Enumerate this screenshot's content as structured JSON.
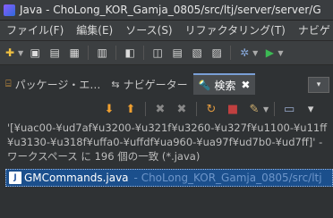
{
  "window": {
    "title": "Java - ChoLong_KOR_Gamja_0805/src/ltj/server/server/G"
  },
  "menu": {
    "items": [
      "ファイル(F)",
      "編集(E)",
      "ソース(S)",
      "リファクタリング(T)",
      "ナビゲ"
    ]
  },
  "views": {
    "tabs": [
      {
        "label": "パッケージ・エ…"
      },
      {
        "label": "ナビゲーター"
      },
      {
        "label": "検索"
      }
    ],
    "close_glyph": "✖",
    "minmax_glyph": "▾"
  },
  "search": {
    "query_line": "'[¥uac00-¥ud7af¥u3200-¥u321f¥u3260-¥u327f¥u1100-¥u11ff¥u3130-¥u318f¥uffa0-¥uffdf¥ua960-¥ua97f¥ud7b0-¥ud7ff]' - ワークスペース に 196 個の一致 (*.java)",
    "results": [
      {
        "icon_letter": "J",
        "name": "GMCommands.java",
        "path": "- ChoLong_KOR_Gamja_0805/src/ltj"
      }
    ]
  }
}
